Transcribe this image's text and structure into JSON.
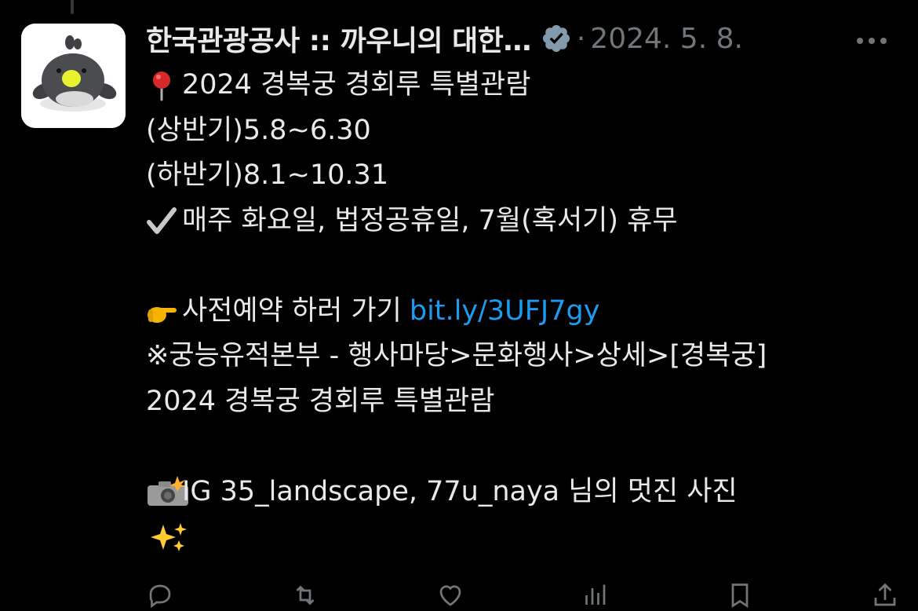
{
  "post": {
    "author": "한국관광공사 :: 까우니의 대한…",
    "separator": "·",
    "date": "2024. 5. 8.",
    "lines": {
      "l1": "2024 경복궁 경회루 특별관람",
      "l2": "(상반기)5.8~6.30",
      "l3": "(하반기)8.1~10.31",
      "l4": "매주 화요일, 법정공휴일, 7월(혹서기) 휴무",
      "l5": "사전예약 하러 가기",
      "l5_link": "bit.ly/3UFJ7gy",
      "l6": "※궁능유적본부 - 행사마당>문화행사>상세>[경복궁]",
      "l7": "2024 경복궁 경회루 특별관람",
      "l8": "IG 35_landscape, 77u_naya 님의 멋진 사진"
    }
  },
  "icons": {
    "verified": "verified-badge-icon",
    "more": "more-options-icon",
    "pin": "round-pushpin-icon",
    "check": "check-mark-icon",
    "point": "pointing-hand-icon",
    "camera": "camera-flash-icon",
    "sparkles": "sparkles-icon"
  },
  "colors": {
    "background": "#000000",
    "text": "#e7e9ea",
    "secondary": "#71767b",
    "link": "#1d9bf0",
    "verified": "#829aab"
  }
}
